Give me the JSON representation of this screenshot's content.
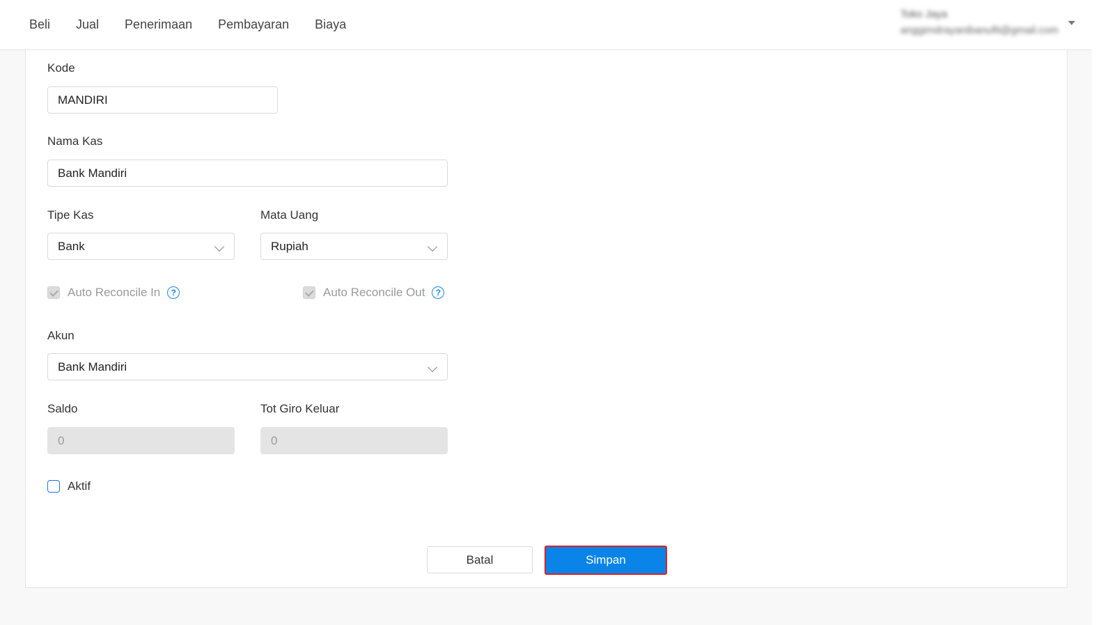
{
  "nav": {
    "items": [
      "Beli",
      "Jual",
      "Penerimaan",
      "Pembayaran",
      "Biaya"
    ]
  },
  "user": {
    "name": "Toko Jaya",
    "email": "anggimdrayanibanufit@gmail.com"
  },
  "form": {
    "kode": {
      "label": "Kode",
      "value": "MANDIRI"
    },
    "nama_kas": {
      "label": "Nama Kas",
      "value": "Bank Mandiri"
    },
    "tipe_kas": {
      "label": "Tipe Kas",
      "value": "Bank"
    },
    "mata_uang": {
      "label": "Mata Uang",
      "value": "Rupiah"
    },
    "auto_reconcile_in": {
      "label": "Auto Reconcile In",
      "checked": true,
      "disabled": true
    },
    "auto_reconcile_out": {
      "label": "Auto Reconcile Out",
      "checked": true,
      "disabled": true
    },
    "help_glyph": "?",
    "akun": {
      "label": "Akun",
      "value": "Bank Mandiri"
    },
    "saldo": {
      "label": "Saldo",
      "value": "0"
    },
    "tot_giro_keluar": {
      "label": "Tot Giro Keluar",
      "value": "0"
    },
    "aktif": {
      "label": "Aktif",
      "checked": false
    }
  },
  "buttons": {
    "cancel": "Batal",
    "save": "Simpan"
  },
  "colors": {
    "primary": "#0a84e8",
    "highlight_border": "#e01e1e"
  }
}
